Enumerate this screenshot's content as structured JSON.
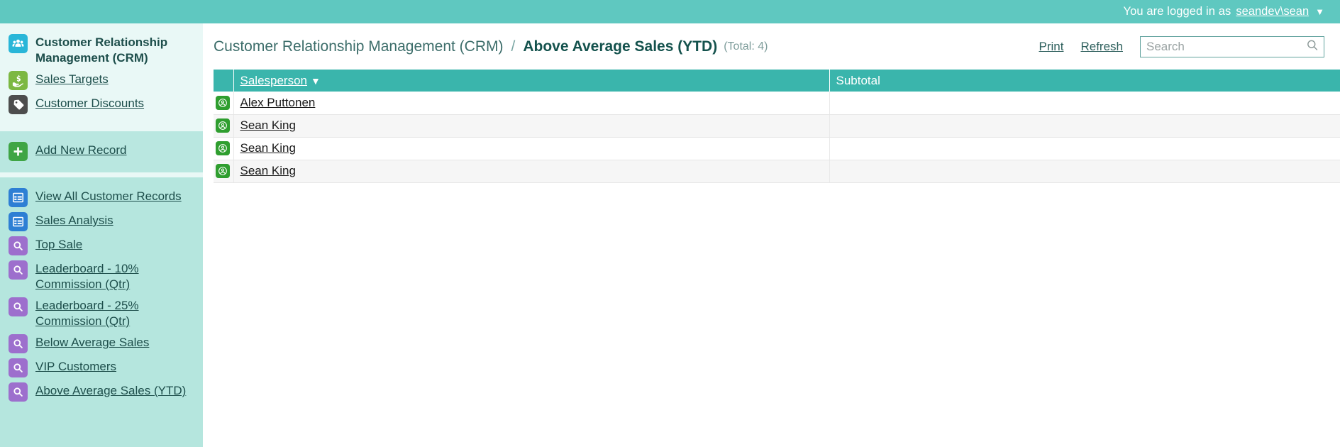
{
  "topbar": {
    "logged_in_text": "You are logged in as",
    "user": "seandev\\sean",
    "caret_icon": "chevron-down-icon"
  },
  "sidebar": {
    "groups": [
      {
        "name": "apps",
        "items": [
          {
            "label": "Customer Relationship Management (CRM)",
            "icon": "people-icon",
            "icon_color": "#29b6d8",
            "style": "title"
          },
          {
            "label": "Sales Targets",
            "icon": "hand-money-icon",
            "icon_color": "#7cb842",
            "style": "link"
          },
          {
            "label": "Customer Discounts",
            "icon": "price-tag-icon",
            "icon_color": "#4d4d4d",
            "style": "link"
          }
        ]
      },
      {
        "name": "actions",
        "items": [
          {
            "label": "Add New Record",
            "icon": "plus-icon",
            "icon_color": "#3fa545",
            "style": "link"
          }
        ]
      },
      {
        "name": "views",
        "items": [
          {
            "label": "View All Customer Records",
            "icon": "table-icon",
            "icon_color": "#2e7fd4",
            "style": "link"
          },
          {
            "label": "Sales Analysis",
            "icon": "table-icon",
            "icon_color": "#2e7fd4",
            "style": "link"
          },
          {
            "label": "Top Sale",
            "icon": "magnifier-icon",
            "icon_color": "#9d6fcd",
            "style": "link"
          },
          {
            "label": "Leaderboard - 10% Commission (Qtr)",
            "icon": "magnifier-icon",
            "icon_color": "#9d6fcd",
            "style": "link"
          },
          {
            "label": "Leaderboard - 25% Commission (Qtr)",
            "icon": "magnifier-icon",
            "icon_color": "#9d6fcd",
            "style": "link"
          },
          {
            "label": "Below Average Sales",
            "icon": "magnifier-icon",
            "icon_color": "#9d6fcd",
            "style": "link"
          },
          {
            "label": "VIP Customers",
            "icon": "magnifier-icon",
            "icon_color": "#9d6fcd",
            "style": "link"
          },
          {
            "label": "Above Average Sales (YTD)",
            "icon": "magnifier-icon",
            "icon_color": "#9d6fcd",
            "style": "link"
          }
        ]
      }
    ]
  },
  "breadcrumb": {
    "root": "Customer Relationship Management (CRM)",
    "separator": "/",
    "current": "Above Average Sales (YTD)",
    "total": "(Total: 4)"
  },
  "actions": {
    "print": "Print",
    "refresh": "Refresh"
  },
  "search": {
    "placeholder": "Search",
    "value": "",
    "icon": "search-icon"
  },
  "table": {
    "columns": [
      {
        "key": "icon",
        "label": ""
      },
      {
        "key": "salesperson",
        "label": "Salesperson",
        "sorted": true,
        "sort_arrow": "▼"
      },
      {
        "key": "subtotal",
        "label": "Subtotal"
      }
    ],
    "rows": [
      {
        "icon": "record-person-icon",
        "salesperson": "Alex Puttonen",
        "subtotal": ""
      },
      {
        "icon": "record-person-icon",
        "salesperson": "Sean King",
        "subtotal": ""
      },
      {
        "icon": "record-person-icon",
        "salesperson": "Sean King",
        "subtotal": ""
      },
      {
        "icon": "record-person-icon",
        "salesperson": "Sean King",
        "subtotal": ""
      }
    ]
  },
  "colors": {
    "topbar": "#5fc8c0",
    "table_header": "#3ab5ac",
    "sidebar_light": "#e9f8f6",
    "sidebar_mid": "#b9e7e0",
    "sidebar_deep": "#b5e6de"
  }
}
